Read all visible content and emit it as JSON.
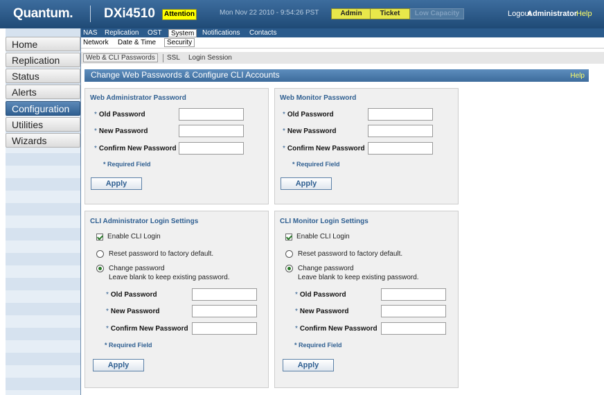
{
  "header": {
    "logo": "Quantum.",
    "product": "DXi4510",
    "attention": "Attention",
    "datetime": "Mon Nov 22 2010 - 9:54:26 PST",
    "admin": "Admin",
    "ticket": "Ticket",
    "low_capacity": "Low Capacity",
    "logout": "Logout",
    "user": "Administrator",
    "help": "Help"
  },
  "sidebar": {
    "items": [
      {
        "label": "Home"
      },
      {
        "label": "Replication"
      },
      {
        "label": "Status"
      },
      {
        "label": "Alerts"
      },
      {
        "label": "Configuration"
      },
      {
        "label": "Utilities"
      },
      {
        "label": "Wizards"
      }
    ]
  },
  "tabs": {
    "top": [
      "NAS",
      "Replication",
      "OST",
      "System",
      "Notifications",
      "Contacts"
    ],
    "sub": [
      "Network",
      "Date & Time",
      "Security"
    ],
    "sub2": [
      "Web & CLI Passwords",
      "SSL",
      "Login Session"
    ]
  },
  "page": {
    "title": "Change Web Passwords & Configure CLI Accounts",
    "help": "Help"
  },
  "web_admin": {
    "title": "Web Administrator Password",
    "old_label": "Old Password",
    "new_label": "New Password",
    "confirm_label": "Confirm New Password",
    "required": "* Required Field",
    "apply": "Apply"
  },
  "web_monitor": {
    "title": "Web Monitor Password",
    "old_label": "Old Password",
    "new_label": "New Password",
    "confirm_label": "Confirm New Password",
    "required": "* Required Field",
    "apply": "Apply"
  },
  "cli_admin": {
    "title": "CLI Administrator Login Settings",
    "enable": "Enable CLI Login",
    "reset": "Reset password to factory default.",
    "change": "Change password",
    "change_note": "Leave blank to keep existing password.",
    "old_label": "Old Password",
    "new_label": "New Password",
    "confirm_label": "Confirm New Password",
    "required": "* Required Field",
    "apply": "Apply"
  },
  "cli_monitor": {
    "title": "CLI Monitor Login Settings",
    "enable": "Enable CLI Login",
    "reset": "Reset password to factory default.",
    "change": "Change password",
    "change_note": "Leave blank to keep existing password.",
    "old_label": "Old Password",
    "new_label": "New Password",
    "confirm_label": "Confirm New Password",
    "required": "* Required Field",
    "apply": "Apply"
  },
  "colors": {
    "header": "#2b5b8c",
    "accent": "#2f5f91",
    "attention": "#ffff00",
    "help": "#ffff66"
  }
}
